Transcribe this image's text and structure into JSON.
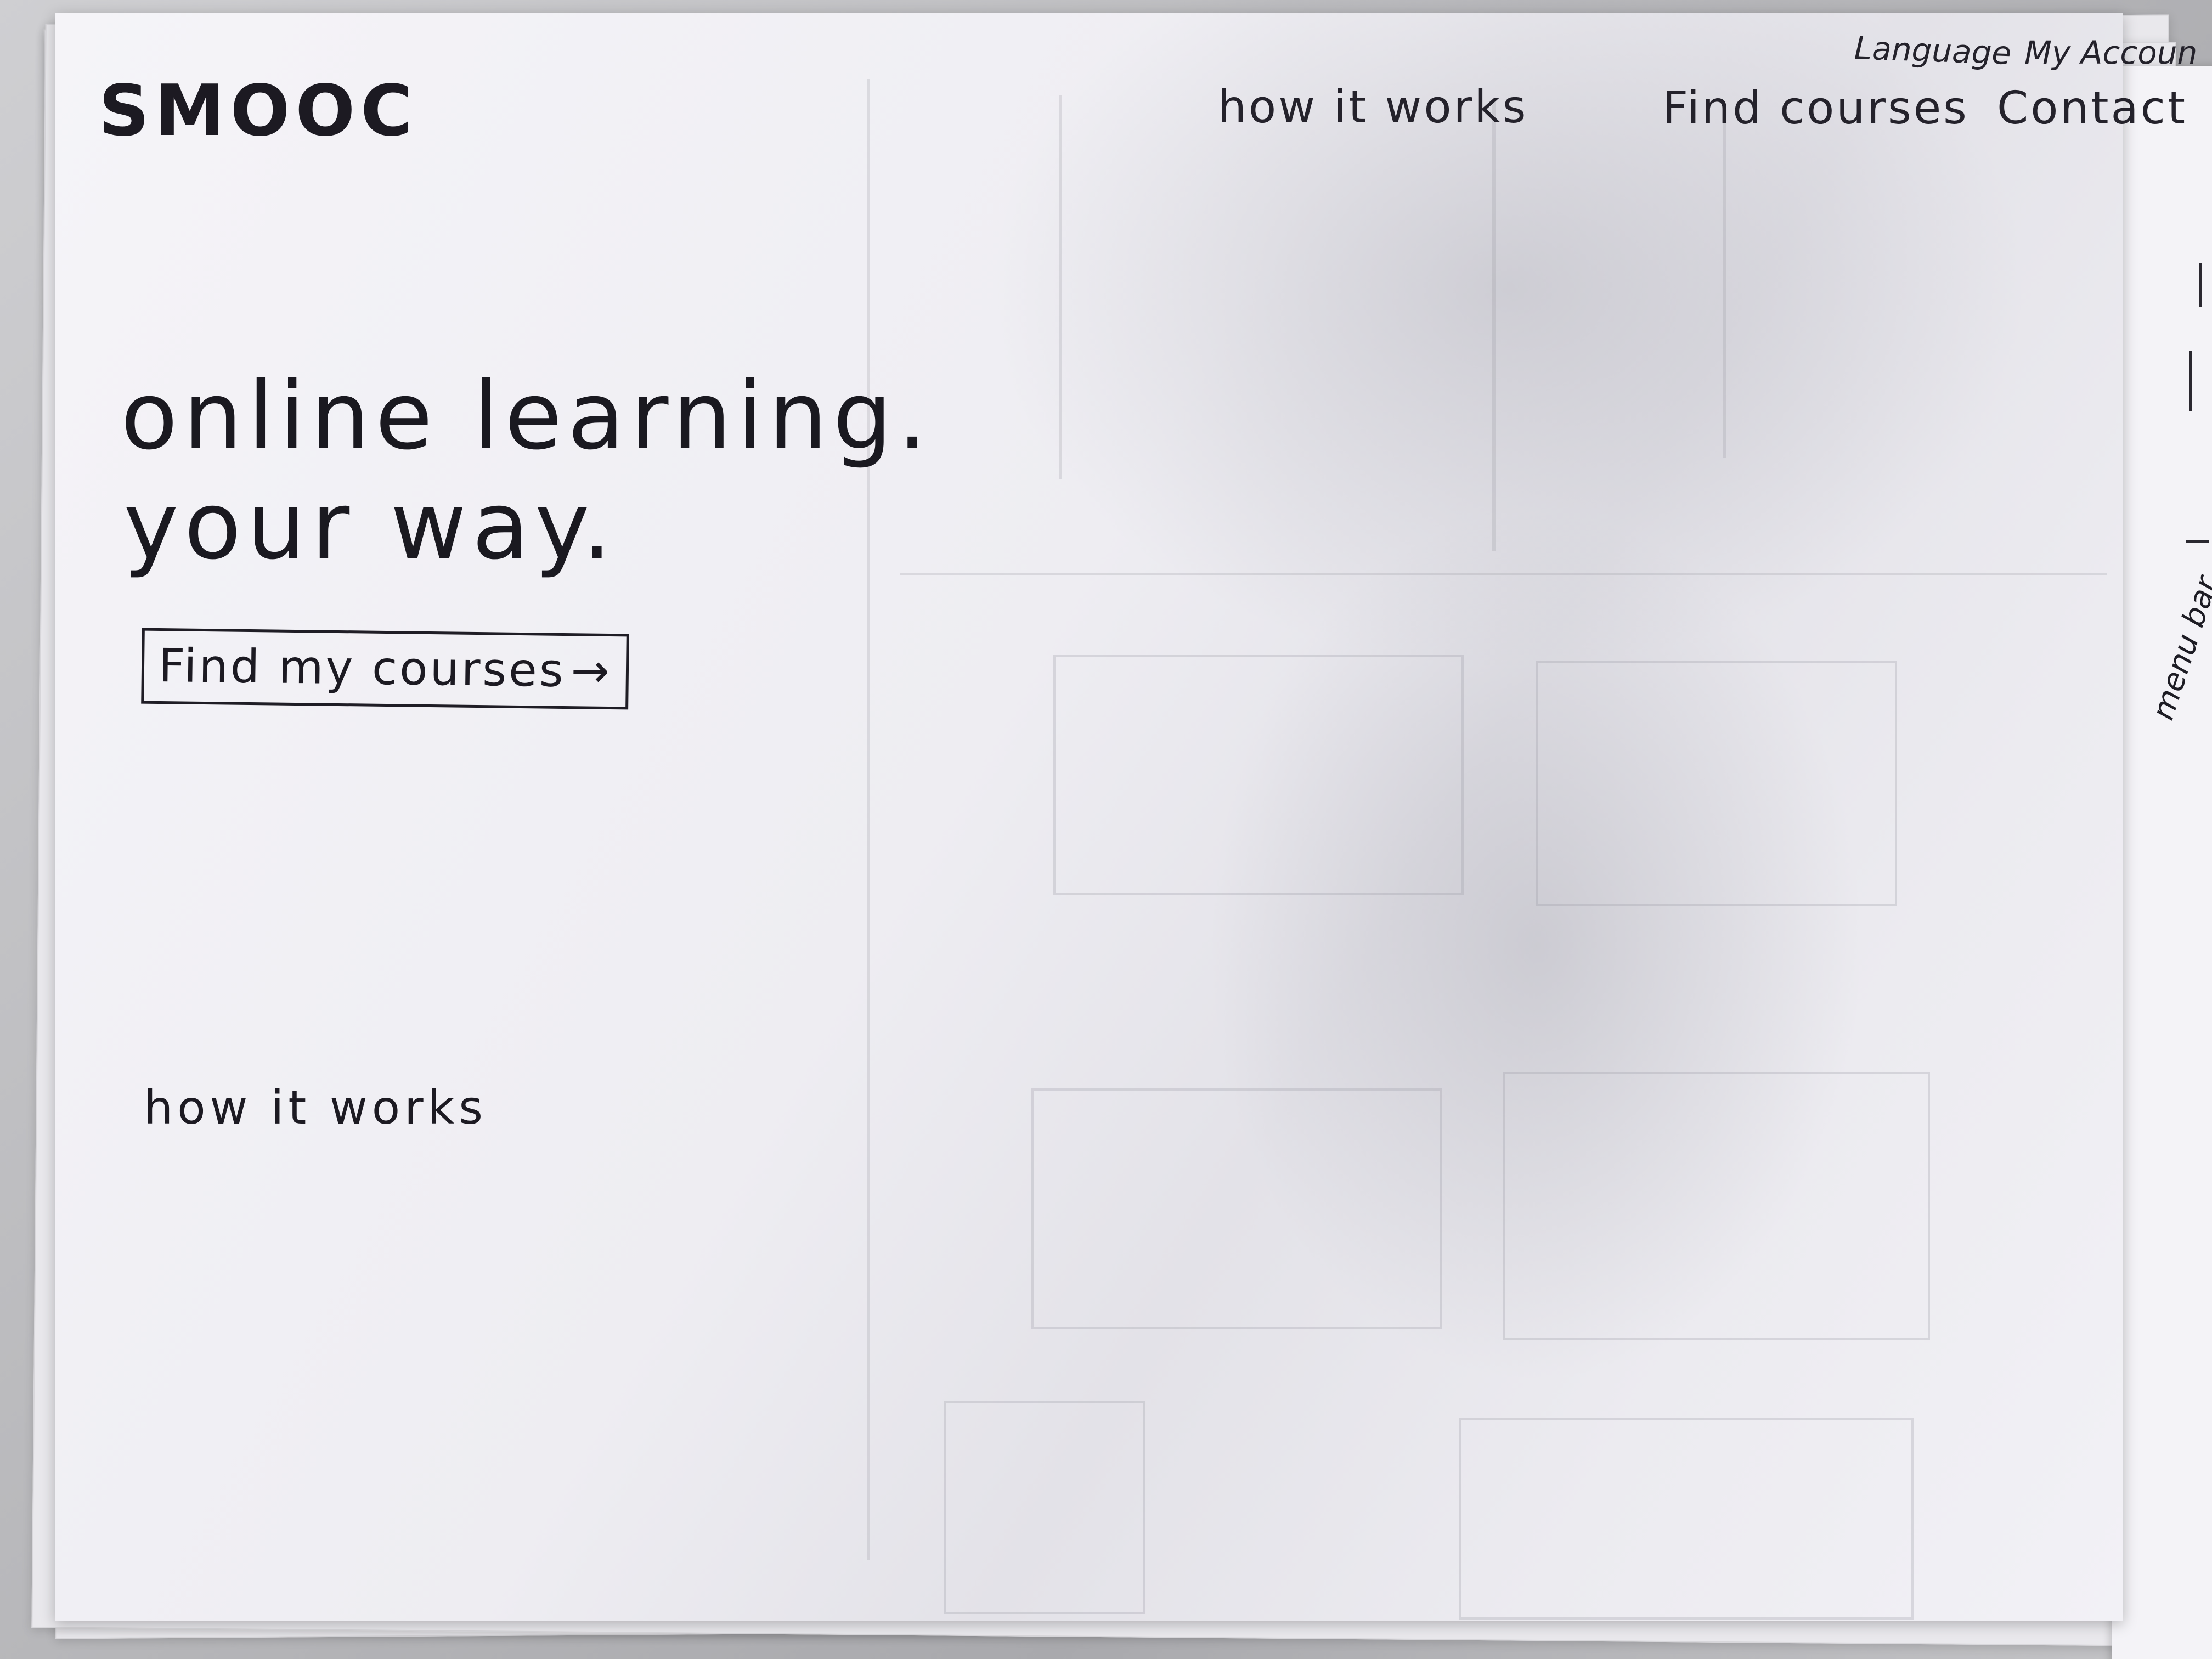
{
  "header": {
    "logo": "SMOOC",
    "nav": [
      {
        "label": "how it works"
      },
      {
        "label": "Find courses"
      },
      {
        "label": "Contact"
      }
    ],
    "utility": [
      {
        "label": "Language"
      },
      {
        "label": "My Accoun"
      }
    ]
  },
  "hero": {
    "line1": "online learning.",
    "line2": "your way.",
    "cta_label": "Find my courses",
    "cta_icon": "arrow-right-icon"
  },
  "sections": {
    "how_it_works": "how it works"
  },
  "side_note": "menu bar."
}
